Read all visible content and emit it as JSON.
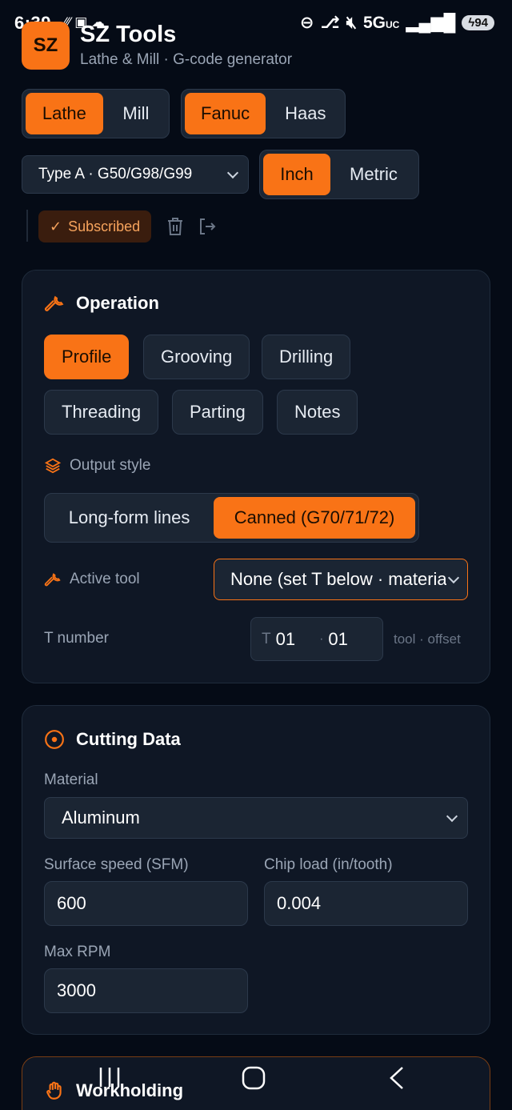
{
  "status": {
    "time": "6:39",
    "network": "5G",
    "network_sub": "UC",
    "battery": "94"
  },
  "header": {
    "logo": "SZ",
    "title": "SZ Tools",
    "subtitle": "Lathe & Mill · G-code generator"
  },
  "machine_toggle": {
    "options": [
      "Lathe",
      "Mill"
    ],
    "selected": "Lathe"
  },
  "control_toggle": {
    "options": [
      "Fanuc",
      "Haas"
    ],
    "selected": "Fanuc"
  },
  "gcode_type": {
    "value": "Type A · G50/G98/G99"
  },
  "units_toggle": {
    "options": [
      "Inch",
      "Metric"
    ],
    "selected": "Inch"
  },
  "account": {
    "status_label": "Subscribed"
  },
  "operation": {
    "title": "Operation",
    "chips": [
      "Profile",
      "Grooving",
      "Drilling",
      "Threading",
      "Parting",
      "Notes"
    ],
    "selected": "Profile",
    "output_style_label": "Output style",
    "output_style_options": [
      "Long-form lines",
      "Canned (G70/71/72)"
    ],
    "output_style_selected": "Canned (G70/71/72)",
    "active_tool_label": "Active tool",
    "active_tool_value": "None (set T below · materia",
    "tnumber_label": "T number",
    "t_prefix": "T",
    "tool_value": "01",
    "offset_sep": "·",
    "offset_value": "01",
    "tool_offset_hint": "tool · offset"
  },
  "cutting": {
    "title": "Cutting Data",
    "material_label": "Material",
    "material_value": "Aluminum",
    "sfm_label": "Surface speed (SFM)",
    "sfm_value": "600",
    "chipload_label": "Chip load (in/tooth)",
    "chipload_value": "0.004",
    "maxrpm_label": "Max RPM",
    "maxrpm_value": "3000"
  },
  "workholding": {
    "title": "Workholding"
  },
  "colors": {
    "accent": "#f97316",
    "background": "#050b16",
    "card": "#0f1725"
  }
}
